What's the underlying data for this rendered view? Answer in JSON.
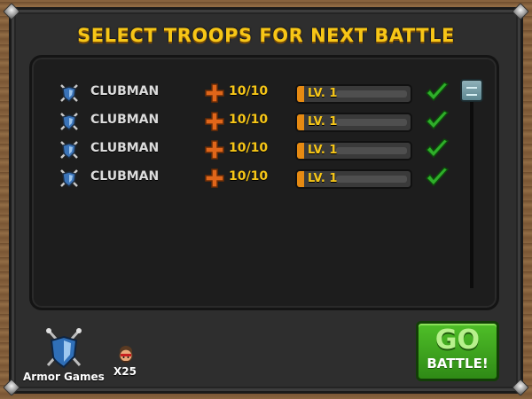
{
  "title": "SELECT TROOPS FOR NEXT BATTLE",
  "troops": [
    {
      "name": "CLUBMAN",
      "health": "10/10",
      "level": "LV. 1",
      "selected": true
    },
    {
      "name": "CLUBMAN",
      "health": "10/10",
      "level": "LV. 1",
      "selected": true
    },
    {
      "name": "CLUBMAN",
      "health": "10/10",
      "level": "LV. 1",
      "selected": true
    },
    {
      "name": "CLUBMAN",
      "health": "10/10",
      "level": "LV. 1",
      "selected": true
    }
  ],
  "go_button": {
    "line1": "GO",
    "line2": "BATTLE!"
  },
  "logo": {
    "text": "Armor Games"
  },
  "units": {
    "count": "X25"
  },
  "icons": {
    "troop": "shield-swords-icon",
    "health": "plus-icon",
    "selected": "checkmark-icon",
    "unit": "warrior-head-icon"
  },
  "colors": {
    "title": "#f7c617",
    "accent_green": "#3aa81e",
    "check_green": "#2fae2a",
    "bar_orange": "#e68a12",
    "panel": "#2e2e2e"
  }
}
